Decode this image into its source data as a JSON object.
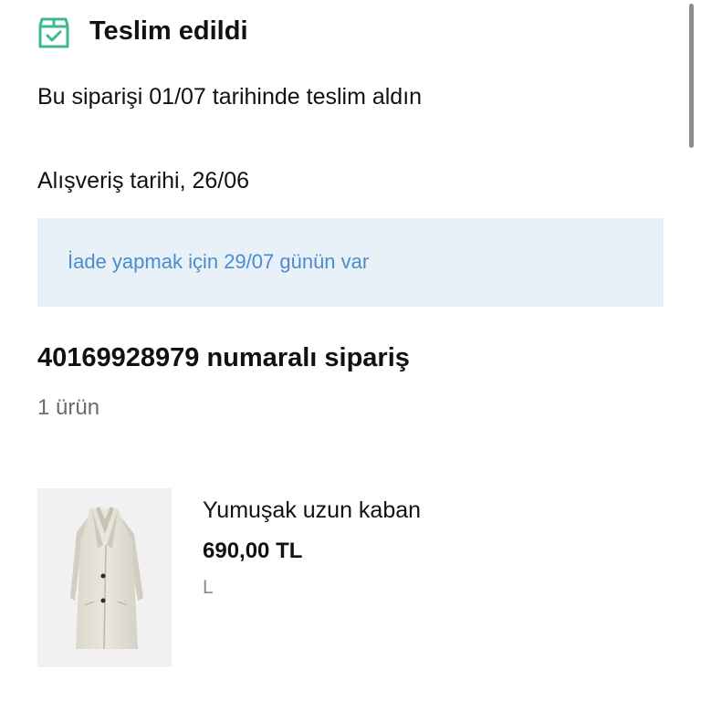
{
  "status": {
    "icon": "package-check-icon",
    "title": "Teslim edildi",
    "color": "#3dba8c"
  },
  "delivery_text": "Bu siparişi 01/07 tarihinde teslim aldın",
  "purchase_date_text": "Alışveriş tarihi, 26/06",
  "return_notice": {
    "text": "İade yapmak için 29/07 günün var",
    "background": "#e8f1f7",
    "text_color": "#4a8ccf"
  },
  "order": {
    "title": "40169928979 numaralı sipariş",
    "item_count": "1 ürün"
  },
  "product": {
    "image": "beige-long-coat-image",
    "name": "Yumuşak uzun kaban",
    "price": "690,00 TL",
    "size": "L"
  }
}
